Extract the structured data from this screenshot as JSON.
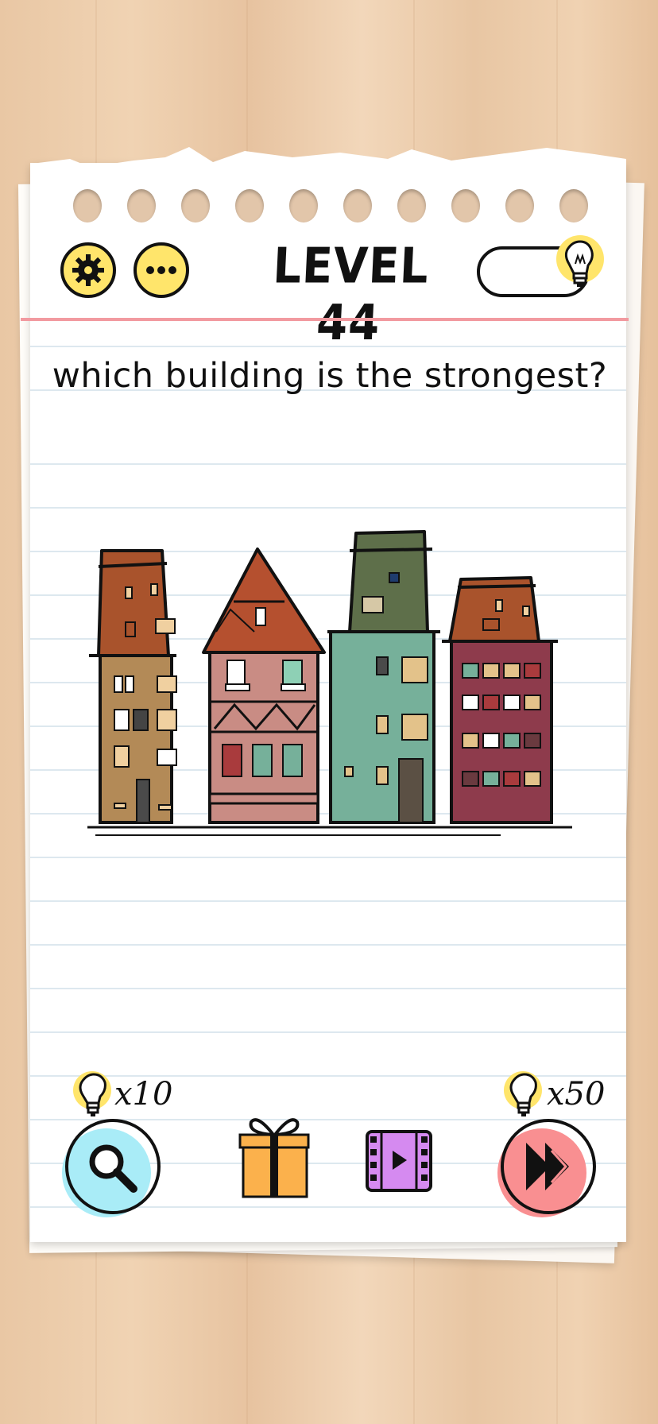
{
  "header": {
    "level_title": "LEVEL 44",
    "settings_icon": "gear-icon",
    "menu_icon": "more-dots-icon",
    "hint_icon": "lightbulb-icon"
  },
  "question": "which building is the strongest?",
  "buildings": [
    {
      "name": "brown-building",
      "color": "#b38a57"
    },
    {
      "name": "pink-building",
      "color": "#c98c84"
    },
    {
      "name": "green-building",
      "color": "#76b09a"
    },
    {
      "name": "red-building",
      "color": "#8e3b4c"
    }
  ],
  "bottom_bar": {
    "search_hint_cost": "x10",
    "skip_hint_cost": "x50",
    "search_icon": "magnifier-icon",
    "gift_icon": "gift-icon",
    "video_icon": "video-icon",
    "skip_icon": "fast-forward-icon"
  },
  "colors": {
    "accent_yellow": "#ffe56b",
    "red_line": "#f29aa0",
    "search_button": "#a9ecf7",
    "skip_button": "#f98f91",
    "gift": "#fbb14c",
    "video": "#d58af0"
  }
}
